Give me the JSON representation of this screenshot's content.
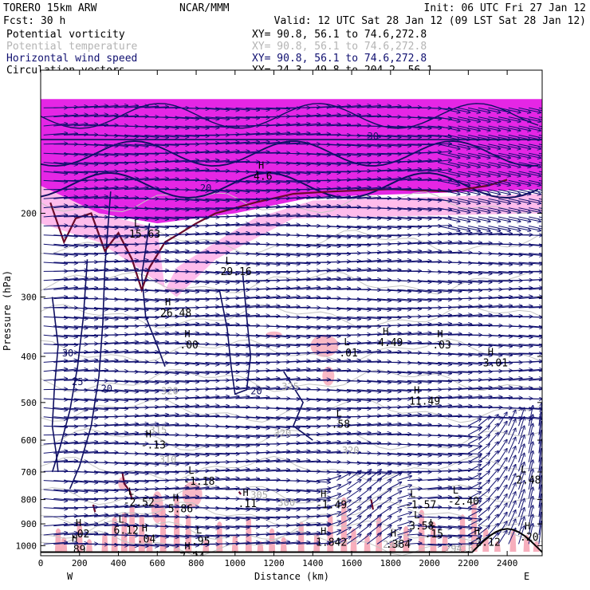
{
  "header": {
    "model": "TORERO  15km ARW",
    "org": "NCAR/MMM",
    "init": "Init: 06 UTC Fri 27 Jan 12",
    "fcst": "Fcst:   30 h",
    "valid": "Valid: 12 UTC Sat 28 Jan 12 (09 LST Sat 28 Jan 12)"
  },
  "fields": [
    {
      "name": "Potential vorticity",
      "xy": "XY=  90.8, 56.1 to  74.6,272.8",
      "color": "#000000"
    },
    {
      "name": "Potential temperature",
      "xy": "XY=  90.8, 56.1 to  74.6,272.8",
      "color": "#b4b4b4"
    },
    {
      "name": "Horizontal wind speed",
      "xy": "XY=  90.8, 56.1 to  74.6,272.8",
      "color": "#101070"
    },
    {
      "name": "Circulation vectors",
      "xy": "XY=  24.3, 49.8 to 204.2, 56.1",
      "color": "#000000"
    }
  ],
  "chart_data": {
    "type": "cross-section",
    "xlabel": "Distance (km)",
    "ylabel": "Pressure (hPa)",
    "xlim": [
      0,
      2580
    ],
    "ylim": [
      1050,
      100
    ],
    "y_scale": "log",
    "x_ticks": [
      "0",
      "200",
      "400",
      "600",
      "800",
      "1000",
      "1200",
      "1400",
      "1600",
      "1800",
      "2000",
      "2200",
      "2400"
    ],
    "y_ticks": [
      "200",
      "300",
      "400",
      "500",
      "600",
      "700",
      "800",
      "900",
      "1000"
    ],
    "x_end_labels": {
      "left": "W",
      "right": "E"
    },
    "wind_speed_labels": [
      {
        "x": 110,
        "p": 400,
        "text": "30"
      },
      {
        "x": 160,
        "p": 460,
        "text": "25"
      },
      {
        "x": 310,
        "p": 475,
        "text": "20"
      },
      {
        "x": 1080,
        "p": 480,
        "text": "20"
      },
      {
        "x": 820,
        "p": 180,
        "text": "20"
      },
      {
        "x": 1680,
        "p": 140,
        "text": "30"
      }
    ],
    "theta_labels": [
      {
        "x": 620,
        "p": 480,
        "text": "320"
      },
      {
        "x": 1240,
        "p": 470,
        "text": "325"
      },
      {
        "x": 1550,
        "p": 640,
        "text": "320"
      },
      {
        "x": 1200,
        "p": 590,
        "text": "320"
      },
      {
        "x": 1080,
        "p": 795,
        "text": "305"
      },
      {
        "x": 1220,
        "p": 825,
        "text": "300"
      },
      {
        "x": 1760,
        "p": 1010,
        "text": "294"
      },
      {
        "x": 2080,
        "p": 1030,
        "text": "294.6"
      },
      {
        "x": 560,
        "p": 580,
        "text": "315"
      },
      {
        "x": 610,
        "p": 670,
        "text": "310"
      }
    ],
    "extrema": [
      {
        "kind": "H",
        "x": 1120,
        "p": 170,
        "value": "4.6"
      },
      {
        "kind": "L",
        "x": 480,
        "p": 225,
        "value": "15.63"
      },
      {
        "kind": "L",
        "x": 950,
        "p": 270,
        "value": "29.16"
      },
      {
        "kind": "H",
        "x": 640,
        "p": 330,
        "value": "26.48"
      },
      {
        "kind": "H",
        "x": 740,
        "p": 385,
        "value": ".00"
      },
      {
        "kind": "L",
        "x": 1560,
        "p": 400,
        "value": ".01"
      },
      {
        "kind": "H",
        "x": 1760,
        "p": 380,
        "value": "4.49"
      },
      {
        "kind": "H",
        "x": 2040,
        "p": 385,
        "value": ".03"
      },
      {
        "kind": "H",
        "x": 2300,
        "p": 420,
        "value": "3.01"
      },
      {
        "kind": "H",
        "x": 1920,
        "p": 505,
        "value": "11.49"
      },
      {
        "kind": "L",
        "x": 1520,
        "p": 565,
        "value": ".58"
      },
      {
        "kind": "H",
        "x": 540,
        "p": 625,
        "value": "-.13"
      },
      {
        "kind": "L",
        "x": 760,
        "p": 745,
        "value": "-1.18"
      },
      {
        "kind": "L",
        "x": 2470,
        "p": 740,
        "value": "2.48"
      },
      {
        "kind": "L",
        "x": 450,
        "p": 825,
        "value": "-2.52"
      },
      {
        "kind": "H",
        "x": 680,
        "p": 850,
        "value": "5.86"
      },
      {
        "kind": "H",
        "x": 1040,
        "p": 830,
        "value": ".11"
      },
      {
        "kind": "H",
        "x": 1440,
        "p": 835,
        "value": "-1.49"
      },
      {
        "kind": "L",
        "x": 1900,
        "p": 835,
        "value": "-1.57"
      },
      {
        "kind": "L",
        "x": 2120,
        "p": 820,
        "value": "-2.40"
      },
      {
        "kind": "H",
        "x": 180,
        "p": 960,
        "value": ".02"
      },
      {
        "kind": "L",
        "x": 400,
        "p": 945,
        "value": "6.12"
      },
      {
        "kind": "H",
        "x": 520,
        "p": 985,
        "value": ".04"
      },
      {
        "kind": "L",
        "x": 800,
        "p": 995,
        "value": ".95"
      },
      {
        "kind": "H",
        "x": 1440,
        "p": 1000,
        "value": "1.842"
      },
      {
        "kind": "H",
        "x": 1800,
        "p": 1010,
        "value": ".384"
      },
      {
        "kind": "L",
        "x": 1920,
        "p": 925,
        "value": "3.58"
      },
      {
        "kind": "L",
        "x": 2000,
        "p": 960,
        "value": ".15"
      },
      {
        "kind": "H",
        "x": 2230,
        "p": 1000,
        "value": "-2.12"
      },
      {
        "kind": "H",
        "x": 2490,
        "p": 975,
        "value": ".20"
      },
      {
        "kind": "H",
        "x": 160,
        "p": 1035,
        "value": ".89"
      },
      {
        "kind": "H",
        "x": 740,
        "p": 1075,
        "value": "7.24"
      }
    ],
    "pv_threshold_shading": "pink-magenta",
    "grid": false,
    "legend": "top-left text list"
  }
}
